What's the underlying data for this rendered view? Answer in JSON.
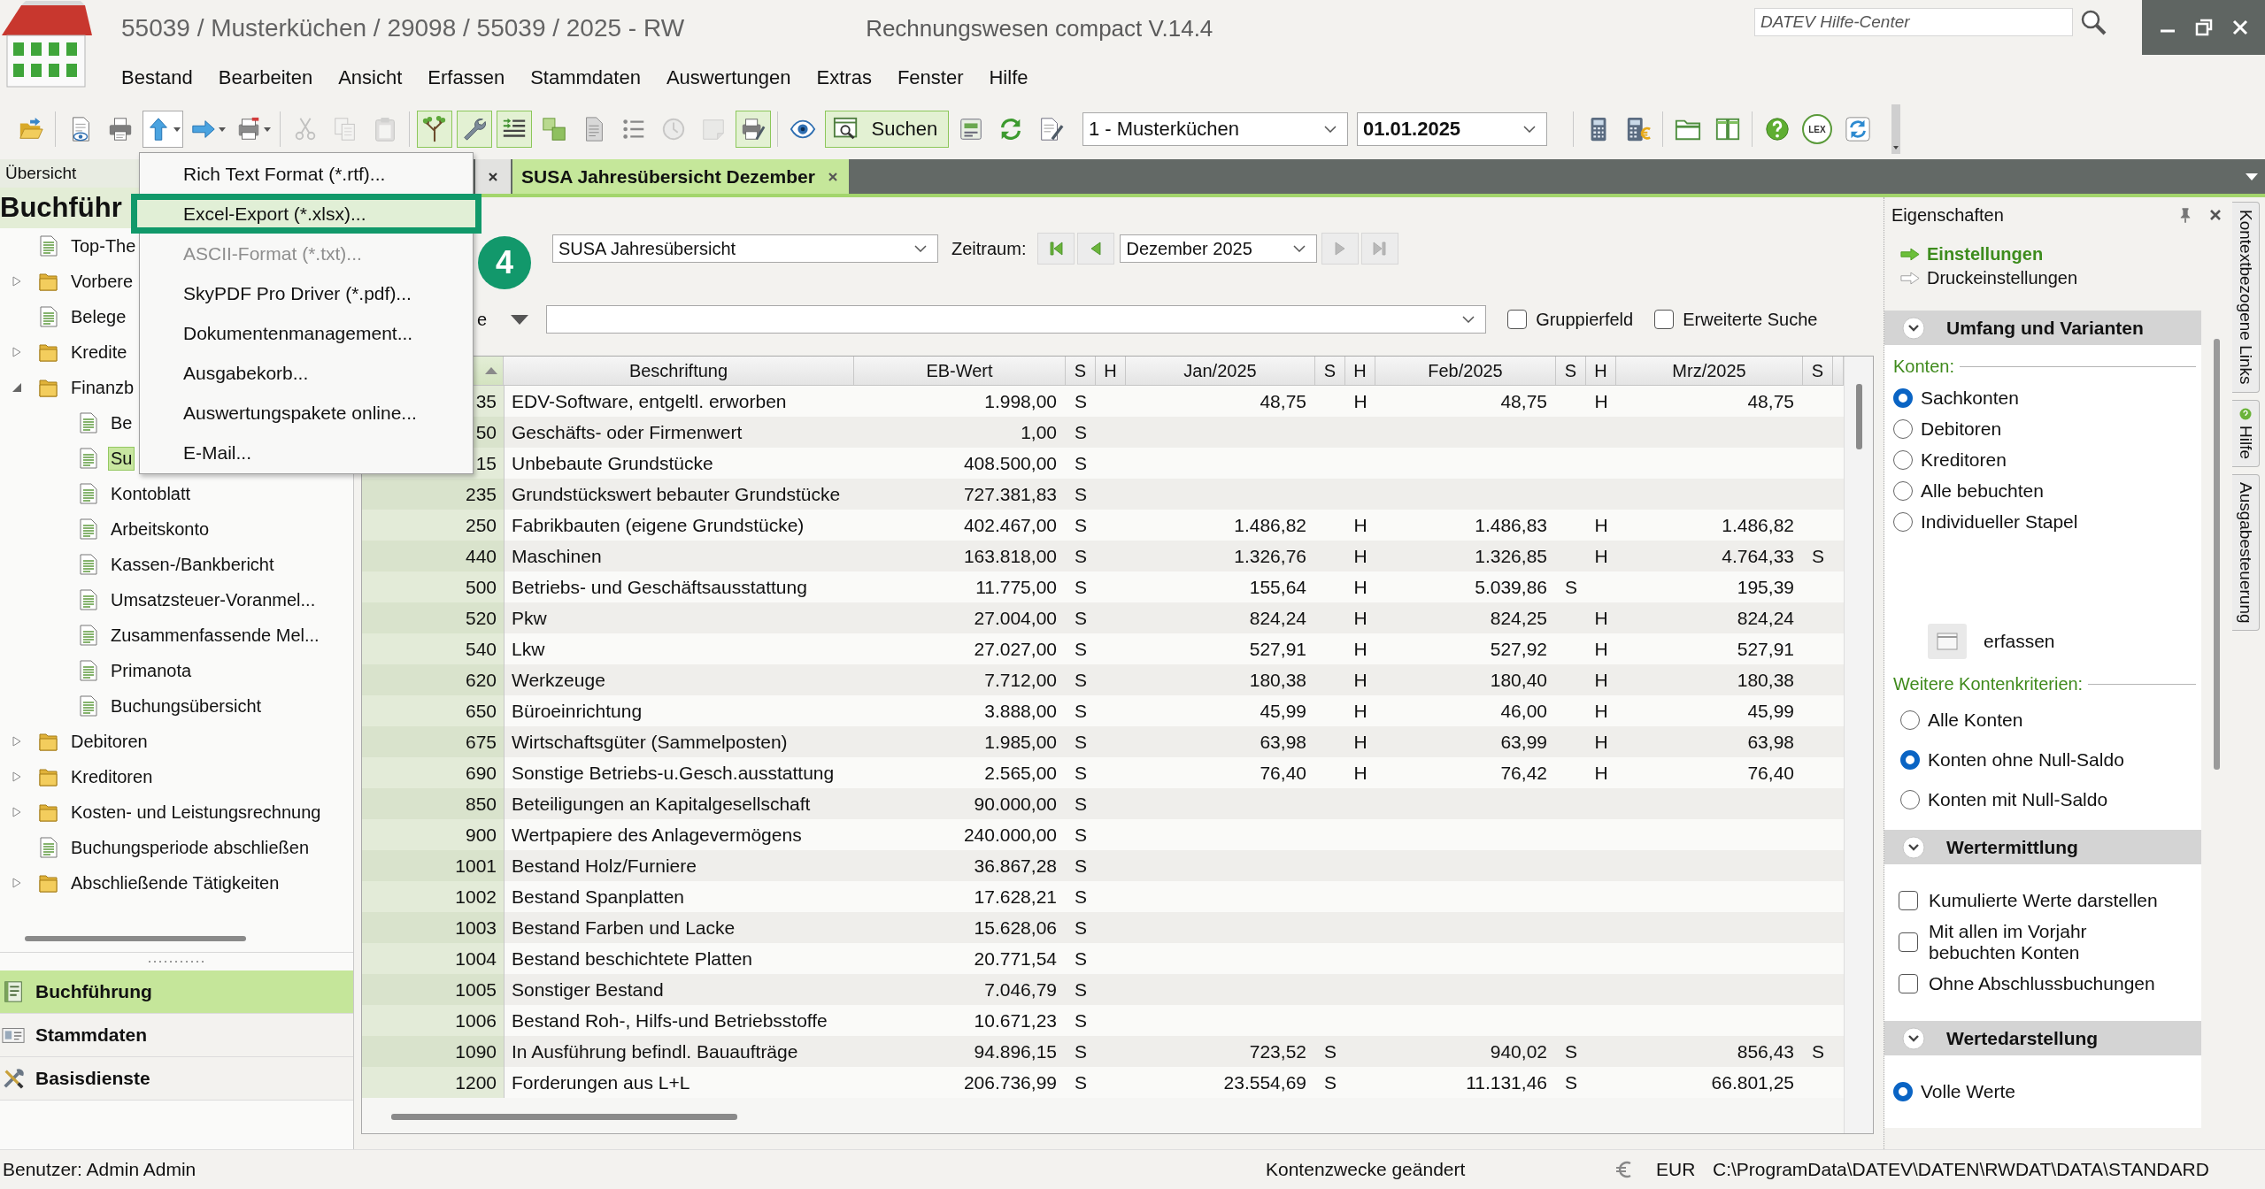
{
  "window": {
    "title": "55039 / Musterküchen / 29098 / 55039 / 2025 - RW",
    "product": "Rechnungswesen compact V.14.4"
  },
  "help_search": {
    "placeholder": "DATEV Hilfe-Center"
  },
  "menu_bar": [
    "Bestand",
    "Bearbeiten",
    "Ansicht",
    "Erfassen",
    "Stammdaten",
    "Auswertungen",
    "Extras",
    "Fenster",
    "Hilfe"
  ],
  "toolbar": {
    "items": [
      {
        "kind": "icon",
        "active": false,
        "disabled": false
      },
      {
        "kind": "separator"
      },
      {
        "kind": "icon",
        "active": false,
        "disabled": false
      },
      {
        "kind": "icon",
        "active": false,
        "disabled": false
      },
      {
        "kind": "menu",
        "active": false,
        "disabled": false,
        "open": true
      },
      {
        "kind": "menu",
        "active": false,
        "disabled": false,
        "open": false
      },
      {
        "kind": "menu",
        "active": false,
        "disabled": false,
        "open": false
      },
      {
        "kind": "separator"
      },
      {
        "kind": "icon",
        "active": false,
        "disabled": true
      },
      {
        "kind": "icon",
        "active": false,
        "disabled": true
      },
      {
        "kind": "icon",
        "active": false,
        "disabled": true
      },
      {
        "kind": "separator"
      },
      {
        "kind": "icon",
        "active": true,
        "disabled": false
      },
      {
        "kind": "icon",
        "active": true,
        "disabled": false
      },
      {
        "kind": "icon",
        "active": true,
        "disabled": false
      },
      {
        "kind": "icon",
        "active": false,
        "disabled": false
      },
      {
        "kind": "icon",
        "active": false,
        "disabled": false
      },
      {
        "kind": "icon",
        "active": false,
        "disabled": false
      },
      {
        "kind": "icon",
        "active": false,
        "disabled": true
      },
      {
        "kind": "icon",
        "active": false,
        "disabled": true
      },
      {
        "kind": "icon",
        "active": true,
        "disabled": false
      },
      {
        "kind": "separator"
      },
      {
        "kind": "icon",
        "active": false,
        "disabled": false
      },
      {
        "kind": "labeled",
        "label": "Suchen",
        "active": true,
        "disabled": false
      },
      {
        "kind": "icon",
        "active": false,
        "disabled": false
      },
      {
        "kind": "icon",
        "active": false,
        "disabled": false
      },
      {
        "kind": "icon",
        "active": false,
        "disabled": false
      },
      {
        "kind": "combo",
        "value": "1 - Musterküchen"
      },
      {
        "kind": "date-field",
        "value": "01.01.2025"
      },
      {
        "kind": "separator"
      },
      {
        "kind": "icon",
        "active": false,
        "disabled": false
      },
      {
        "kind": "icon",
        "active": false,
        "disabled": false
      },
      {
        "kind": "separator"
      },
      {
        "kind": "icon",
        "active": false,
        "disabled": false
      },
      {
        "kind": "icon",
        "active": false,
        "disabled": false
      },
      {
        "kind": "separator"
      },
      {
        "kind": "icon",
        "active": false,
        "disabled": false
      },
      {
        "kind": "text",
        "label": "LEX",
        "active": false,
        "disabled": false
      },
      {
        "kind": "icon",
        "active": false,
        "disabled": false
      }
    ]
  },
  "overview_pane": {
    "title": "Übersicht",
    "heading": "Buchführ",
    "tree": [
      {
        "label": "Top-The",
        "kind": "document",
        "selected": false
      },
      {
        "label": "Vorbere",
        "kind": "folder",
        "expanded": false,
        "selected": false
      },
      {
        "label": "Belege",
        "kind": "document",
        "selected": false
      },
      {
        "label": "Kredite",
        "kind": "folder",
        "expanded": false,
        "selected": false
      },
      {
        "label": "Finanzb",
        "kind": "folder",
        "expanded": true,
        "selected": false,
        "children": [
          {
            "label": "Be",
            "kind": "document",
            "selected": false
          },
          {
            "label": "Su",
            "kind": "document",
            "selected": true
          },
          {
            "label": "Kontoblatt",
            "kind": "document",
            "selected": false
          },
          {
            "label": "Arbeitskonto",
            "kind": "document",
            "selected": false
          },
          {
            "label": "Kassen-/Bankbericht",
            "kind": "document",
            "selected": false
          },
          {
            "label": "Umsatzsteuer-Voranmel...",
            "kind": "document",
            "selected": false
          },
          {
            "label": "Zusammenfassende Mel...",
            "kind": "document",
            "selected": false
          },
          {
            "label": "Primanota",
            "kind": "document",
            "selected": false
          },
          {
            "label": "Buchungsübersicht",
            "kind": "document",
            "selected": false
          }
        ]
      },
      {
        "label": "Debitoren",
        "kind": "folder",
        "expanded": false,
        "selected": false
      },
      {
        "label": "Kreditoren",
        "kind": "folder",
        "expanded": false,
        "selected": false
      },
      {
        "label": "Kosten- und Leistungsrechnung",
        "kind": "folder",
        "expanded": false,
        "selected": false
      },
      {
        "label": "Buchungsperiode abschließen",
        "kind": "document",
        "selected": false
      },
      {
        "label": "Abschließende Tätigkeiten",
        "kind": "folder",
        "expanded": false,
        "selected": false
      }
    ],
    "nav": [
      {
        "label": "Buchführung",
        "selected": true
      },
      {
        "label": "Stammdaten",
        "selected": false
      },
      {
        "label": "Basisdienste",
        "selected": false
      }
    ]
  },
  "tabs": [
    {
      "selected": false
    },
    {
      "label": "SUSA Jahresübersicht Dezember",
      "selected": true
    }
  ],
  "export_menu": {
    "items": [
      {
        "label": "Rich Text Format (*.rtf)...",
        "disabled": false,
        "selected": false
      },
      {
        "label": "Excel-Export (*.xlsx)...",
        "disabled": false,
        "selected": true
      },
      {
        "label": "ASCII-Format (*.txt)...",
        "disabled": true,
        "selected": false
      },
      {
        "label": "SkyPDF Pro Driver (*.pdf)...",
        "disabled": false,
        "selected": false
      },
      {
        "label": "Dokumentenmanagement...",
        "disabled": false,
        "selected": false
      },
      {
        "label": "Ausgabekorb...",
        "disabled": false,
        "selected": false
      },
      {
        "label": "Auswertungspakete online...",
        "disabled": false,
        "selected": false
      },
      {
        "label": "E-Mail...",
        "disabled": false,
        "selected": false
      }
    ]
  },
  "step_marker": "4",
  "report": {
    "selector": "SUSA Jahresübersicht",
    "period_label": "Zeitraum:",
    "period": "Dezember 2025",
    "period_nav": [
      {
        "kind": "first",
        "disabled": false
      },
      {
        "kind": "previous",
        "disabled": false
      },
      {
        "kind": "next",
        "disabled": true
      },
      {
        "kind": "last",
        "disabled": true
      }
    ],
    "filter_label": "e",
    "options": [
      {
        "label": "Gruppierfeld",
        "checked": false
      },
      {
        "label": "Erweiterte Suche",
        "checked": false
      }
    ]
  },
  "table": {
    "columns": [
      {
        "sorted": true
      },
      {
        "label": "Beschriftung",
        "sorted": false
      },
      {
        "label": "EB-Wert",
        "sorted": false
      },
      {
        "label": "S",
        "sorted": false
      },
      {
        "label": "H",
        "sorted": false
      },
      {
        "label": "Jan/2025",
        "sorted": false
      },
      {
        "label": "S",
        "sorted": false
      },
      {
        "label": "H",
        "sorted": false
      },
      {
        "label": "Feb/2025",
        "sorted": false
      },
      {
        "label": "S",
        "sorted": false
      },
      {
        "label": "H",
        "sorted": false
      },
      {
        "label": "Mrz/2025",
        "sorted": false
      },
      {
        "label": "S",
        "sorted": false
      }
    ],
    "rows": [
      {
        "account": "35",
        "label": "EDV-Software, entgeltl. erworben",
        "eb_value": "1.998,00",
        "eb_s": "S",
        "months": [
          {
            "value": "48,75",
            "h": "H"
          },
          {
            "value": "48,75",
            "h": "H"
          },
          {
            "value": "48,75"
          }
        ]
      },
      {
        "account": "50",
        "label": "Geschäfts- oder Firmenwert",
        "eb_value": "1,00",
        "eb_s": "S"
      },
      {
        "account": "15",
        "label": "Unbebaute Grundstücke",
        "eb_value": "408.500,00",
        "eb_s": "S"
      },
      {
        "account": "235",
        "label": "Grundstückswert bebauter Grundstücke",
        "eb_value": "727.381,83",
        "eb_s": "S"
      },
      {
        "account": "250",
        "label": "Fabrikbauten (eigene Grundstücke)",
        "eb_value": "402.467,00",
        "eb_s": "S",
        "months": [
          {
            "value": "1.486,82",
            "h": "H"
          },
          {
            "value": "1.486,83",
            "h": "H"
          },
          {
            "value": "1.486,82"
          }
        ]
      },
      {
        "account": "440",
        "label": "Maschinen",
        "eb_value": "163.818,00",
        "eb_s": "S",
        "months": [
          {
            "value": "1.326,76",
            "h": "H"
          },
          {
            "value": "1.326,85",
            "h": "H"
          },
          {
            "value": "4.764,33",
            "s": "S"
          }
        ]
      },
      {
        "account": "500",
        "label": "Betriebs- und Geschäftsausstattung",
        "eb_value": "11.775,00",
        "eb_s": "S",
        "months": [
          {
            "value": "155,64",
            "h": "H"
          },
          {
            "value": "5.039,86",
            "s": "S"
          },
          {
            "value": "195,39"
          }
        ]
      },
      {
        "account": "520",
        "label": "Pkw",
        "eb_value": "27.004,00",
        "eb_s": "S",
        "months": [
          {
            "value": "824,24",
            "h": "H"
          },
          {
            "value": "824,25",
            "h": "H"
          },
          {
            "value": "824,24"
          }
        ]
      },
      {
        "account": "540",
        "label": "Lkw",
        "eb_value": "27.027,00",
        "eb_s": "S",
        "months": [
          {
            "value": "527,91",
            "h": "H"
          },
          {
            "value": "527,92",
            "h": "H"
          },
          {
            "value": "527,91"
          }
        ]
      },
      {
        "account": "620",
        "label": "Werkzeuge",
        "eb_value": "7.712,00",
        "eb_s": "S",
        "months": [
          {
            "value": "180,38",
            "h": "H"
          },
          {
            "value": "180,40",
            "h": "H"
          },
          {
            "value": "180,38"
          }
        ]
      },
      {
        "account": "650",
        "label": "Büroeinrichtung",
        "eb_value": "3.888,00",
        "eb_s": "S",
        "months": [
          {
            "value": "45,99",
            "h": "H"
          },
          {
            "value": "46,00",
            "h": "H"
          },
          {
            "value": "45,99"
          }
        ]
      },
      {
        "account": "675",
        "label": "Wirtschaftsgüter (Sammelposten)",
        "eb_value": "1.985,00",
        "eb_s": "S",
        "months": [
          {
            "value": "63,98",
            "h": "H"
          },
          {
            "value": "63,99",
            "h": "H"
          },
          {
            "value": "63,98"
          }
        ]
      },
      {
        "account": "690",
        "label": "Sonstige Betriebs-u.Gesch.ausstattung",
        "eb_value": "2.565,00",
        "eb_s": "S",
        "months": [
          {
            "value": "76,40",
            "h": "H"
          },
          {
            "value": "76,42",
            "h": "H"
          },
          {
            "value": "76,40"
          }
        ]
      },
      {
        "account": "850",
        "label": "Beteiligungen an Kapitalgesellschaft",
        "eb_value": "90.000,00",
        "eb_s": "S"
      },
      {
        "account": "900",
        "label": "Wertpapiere des Anlagevermögens",
        "eb_value": "240.000,00",
        "eb_s": "S"
      },
      {
        "account": "1001",
        "label": "Bestand Holz/Furniere",
        "eb_value": "36.867,28",
        "eb_s": "S"
      },
      {
        "account": "1002",
        "label": "Bestand Spanplatten",
        "eb_value": "17.628,21",
        "eb_s": "S"
      },
      {
        "account": "1003",
        "label": "Bestand Farben und Lacke",
        "eb_value": "15.628,06",
        "eb_s": "S"
      },
      {
        "account": "1004",
        "label": "Bestand beschichtete Platten",
        "eb_value": "20.771,54",
        "eb_s": "S"
      },
      {
        "account": "1005",
        "label": "Sonstiger Bestand",
        "eb_value": "7.046,79",
        "eb_s": "S"
      },
      {
        "account": "1006",
        "label": "Bestand Roh-, Hilfs-und Betriebsstoffe",
        "eb_value": "10.671,23",
        "eb_s": "S"
      },
      {
        "account": "1090",
        "label": "In Ausführung befindl. Bauaufträge",
        "eb_value": "94.896,15",
        "eb_s": "S",
        "months": [
          {
            "value": "723,52",
            "s": "S"
          },
          {
            "value": "940,02",
            "s": "S"
          },
          {
            "value": "856,43",
            "s": "S"
          }
        ]
      },
      {
        "account": "1200",
        "label": "Forderungen aus L+L",
        "eb_value": "206.736,99",
        "eb_s": "S",
        "months": [
          {
            "value": "23.554,69",
            "s": "S"
          },
          {
            "value": "11.131,46",
            "s": "S"
          },
          {
            "value": "66.801,25"
          }
        ]
      }
    ]
  },
  "properties_pane": {
    "title": "Eigenschaften",
    "links": [
      {
        "label": "Einstellungen",
        "selected": true
      },
      {
        "label": "Druckeinstellungen",
        "selected": false
      }
    ],
    "sections": [
      {
        "title": "Umfang und Varianten",
        "expanded": true,
        "groups": [
          {
            "label": "Konten:",
            "items": [
              {
                "kind": "radio",
                "label": "Sachkonten",
                "selected": true
              },
              {
                "kind": "radio",
                "label": "Debitoren",
                "selected": false
              },
              {
                "kind": "radio",
                "label": "Kreditoren",
                "selected": false
              },
              {
                "kind": "radio",
                "label": "Alle bebuchten",
                "selected": false
              },
              {
                "kind": "radio",
                "label": "Individueller Stapel",
                "selected": false
              },
              {
                "kind": "button",
                "label": "erfassen"
              }
            ]
          },
          {
            "label": "Weitere Kontenkriterien:",
            "items": [
              {
                "kind": "radio",
                "label": "Alle Konten",
                "selected": false
              },
              {
                "kind": "radio",
                "label": "Konten ohne Null-Saldo",
                "selected": true
              },
              {
                "kind": "radio",
                "label": "Konten mit Null-Saldo",
                "selected": false
              }
            ]
          }
        ]
      },
      {
        "title": "Wertermittlung",
        "expanded": true,
        "groups": [
          {
            "items": [
              {
                "kind": "checkbox",
                "label": "Kumulierte Werte darstellen",
                "checked": false
              },
              {
                "kind": "checkbox",
                "label": "Mit allen im Vorjahr bebuchten Konten",
                "checked": false
              },
              {
                "kind": "checkbox",
                "label": "Ohne Abschlussbuchungen",
                "checked": false
              }
            ]
          }
        ]
      },
      {
        "title": "Wertedarstellung",
        "expanded": true,
        "groups": [
          {
            "items": [
              {
                "kind": "radio",
                "label": "Volle Werte",
                "selected": true
              }
            ]
          }
        ]
      }
    ]
  },
  "side_tabs": [
    {
      "label": "Kontextbezogene Links",
      "kind": "links"
    },
    {
      "label": "Hilfe",
      "kind": "help"
    },
    {
      "label": "Ausgabesteuerung",
      "kind": "output"
    }
  ],
  "status_bar": {
    "user": "Benutzer: Admin Admin",
    "message": "Kontenzwecke geändert",
    "currency": "EUR",
    "path": "C:\\ProgramData\\DATEV\\DATEN\\RWDAT\\DATA\\STANDARD"
  }
}
